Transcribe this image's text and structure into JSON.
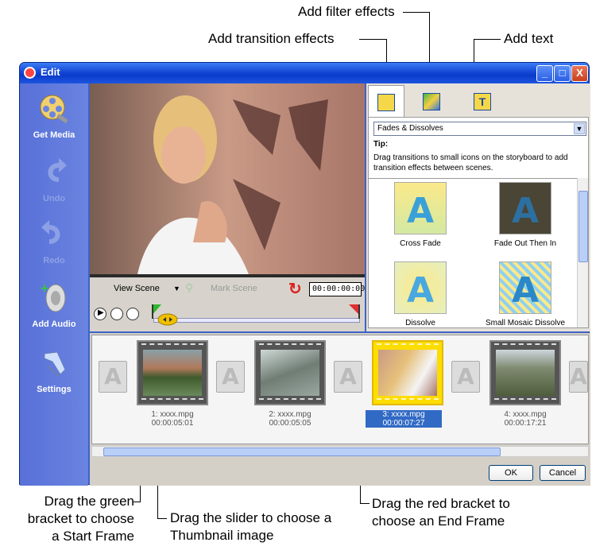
{
  "callouts": {
    "filter": "Add filter effects",
    "transition": "Add transition effects",
    "text": "Add text",
    "green_bracket": "Drag the green\nbracket to choose\na Start Frame",
    "slider": "Drag the slider to choose a\nThumbnail image",
    "red_bracket": "Drag the red bracket to\nchoose an End Frame"
  },
  "window": {
    "title": "Edit",
    "min": "_",
    "max": "□",
    "close": "X"
  },
  "sidebar": {
    "items": [
      {
        "label": "Get Media",
        "icon": "film-reel-icon",
        "enabled": true
      },
      {
        "label": "Undo",
        "icon": "undo-arrow-icon",
        "enabled": false
      },
      {
        "label": "Redo",
        "icon": "redo-arrow-icon",
        "enabled": false
      },
      {
        "label": "Add Audio",
        "icon": "speaker-icon",
        "enabled": true
      },
      {
        "label": "Settings",
        "icon": "settings-icon",
        "enabled": true
      }
    ]
  },
  "preview": {
    "view_scene": "View Scene",
    "mark_scene": "Mark Scene",
    "timecode": "00:00:00:00"
  },
  "panel": {
    "tabs": [
      "transition-tab-icon",
      "filter-tab-icon",
      "text-tab-icon"
    ],
    "category": "Fades & Dissolves",
    "tip_label": "Tip:",
    "tip_text": "Drag transitions to small icons on the storyboard to add transition effects between scenes.",
    "effects": [
      {
        "name": "Cross Fade",
        "glyph": "A"
      },
      {
        "name": "Fade Out Then In",
        "glyph": "A"
      },
      {
        "name": "Dissolve",
        "glyph": "A"
      },
      {
        "name": "Small Mosaic Dissolve",
        "glyph": "A"
      }
    ]
  },
  "storyboard": {
    "clips": [
      {
        "name": "1: xxxx.mpg",
        "duration": "00:00:05:01",
        "selected": false
      },
      {
        "name": "2: xxxx.mpg",
        "duration": "00:00:05:05",
        "selected": false
      },
      {
        "name": "3: xxxx.mpg",
        "duration": "00:00:07:27",
        "selected": true
      },
      {
        "name": "4: xxxx.mpg",
        "duration": "00:00:17:21",
        "selected": false
      }
    ],
    "transition_glyph": "A"
  },
  "buttons": {
    "ok": "OK",
    "cancel": "Cancel"
  },
  "colors": {
    "sidebar": "#5870d8",
    "selection": "#316ac5",
    "selected_frame": "#fddc00"
  }
}
